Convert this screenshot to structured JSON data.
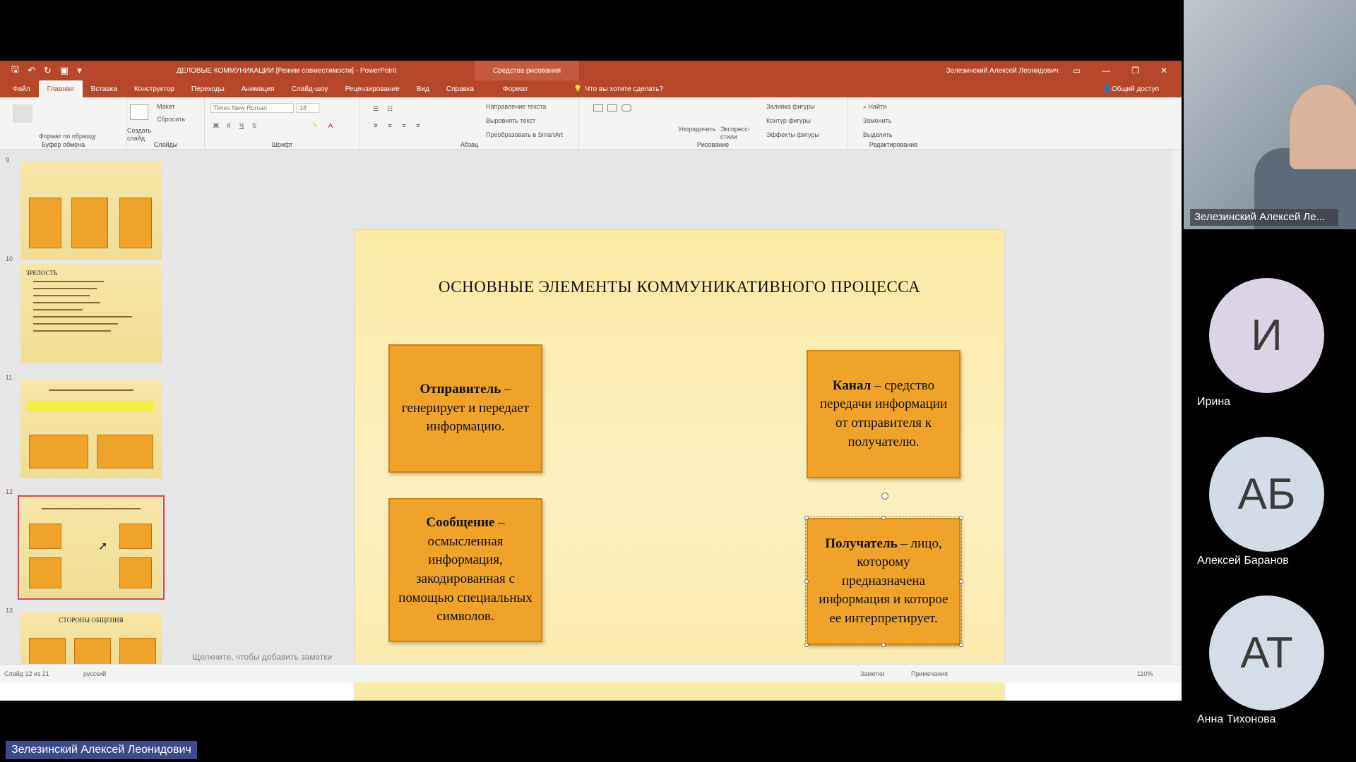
{
  "app": {
    "window_title": "ДЕЛОВЫЕ КОММУНИКАЦИИ [Режим совместимости] - PowerPoint",
    "context_tab_group": "Средства рисования",
    "user": "Зелезинский Алексей Леонидович"
  },
  "tabs": [
    "Файл",
    "Главная",
    "Вставка",
    "Конструктор",
    "Переходы",
    "Анимация",
    "Слайд-шоу",
    "Рецензирование",
    "Вид",
    "Справка"
  ],
  "tab_format": "Формат",
  "tell_me": "Что вы хотите сделать?",
  "share": "Общий доступ",
  "ribbon": {
    "clipboard": {
      "label": "Буфер обмена",
      "format_painter": "Формат по образцу"
    },
    "slides": {
      "label": "Слайды",
      "new_slide": "Создать слайд",
      "layout": "Макет",
      "reset": "Сбросить"
    },
    "font": {
      "label": "Шрифт",
      "font_name": "Times New Roman",
      "font_size": "18"
    },
    "paragraph": {
      "label": "Абзац",
      "text_direction": "Направление текста",
      "align_text": "Выровнять текст",
      "smartart": "Преобразовать в SmartArt"
    },
    "drawing": {
      "label": "Рисование",
      "arrange": "Упорядочить",
      "quick_styles": "Экспресс-стили",
      "shape_fill": "Заливка фигуры",
      "shape_outline": "Контур фигуры",
      "shape_effects": "Эффекты фигуры"
    },
    "editing": {
      "label": "Редактирование",
      "find": "Найти",
      "replace": "Заменить",
      "select": "Выделить"
    }
  },
  "thumbnails": [
    {
      "number": "9"
    },
    {
      "number": "10",
      "text_title": "ЗРЕЛОСТЬ"
    },
    {
      "number": "11"
    },
    {
      "number": "12"
    },
    {
      "number": "13",
      "text_title": "СТОРОНЫ ОБЩЕНИЯ"
    }
  ],
  "slide": {
    "title": "ОСНОВНЫЕ ЭЛЕМЕНТЫ КОММУНИКАТИВНОГО ПРОЦЕССА",
    "boxes": {
      "sender": {
        "term": "Отправитель",
        "text": " – генерирует и передает информацию."
      },
      "message": {
        "term": "Сообщение",
        "text": " – осмысленная информация, закодированная с помощью специальных символов."
      },
      "channel": {
        "term": "Канал",
        "text": " – средство передачи информации от отправителя к получателю."
      },
      "receiver": {
        "term": "Получатель",
        "text": " – лицо, которому предназначена информация и которое ее интерпретирует."
      }
    }
  },
  "notes_placeholder": "Щелкните, чтобы добавить заметки",
  "status": {
    "slide_counter": "Слайд 12 из 21",
    "language": "русский",
    "notes": "Заметки",
    "comments": "Примечания",
    "zoom": "110%"
  },
  "participants": {
    "presenter_label": "Зелезинский Алексей Ле...",
    "list": [
      {
        "initials": "И",
        "name": "Ирина",
        "color": "#dcd3e6"
      },
      {
        "initials": "АБ",
        "name": "Алексей Баранов",
        "color": "#d2dce8"
      },
      {
        "initials": "АТ",
        "name": "Анна Тихонова",
        "color": "#d4dde8"
      }
    ]
  },
  "presenter_bar": "Зелезинский Алексей Леонидович"
}
